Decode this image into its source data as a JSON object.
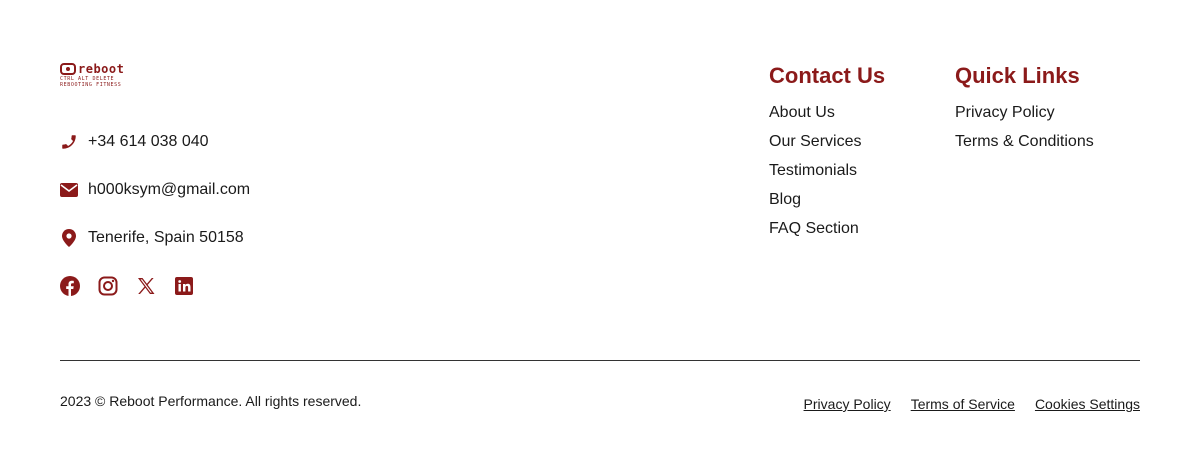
{
  "brand": {
    "logo_word": "reboot",
    "logo_tag_line1": "CTRL ALT DELETE",
    "logo_tag_line2": "REBOOTING FITNESS",
    "accent_color": "#8b1a1a"
  },
  "contact_info": {
    "phone": "+34 614 038 040",
    "email": "h000ksym@gmail.com",
    "location": "Tenerife, Spain 50158"
  },
  "socials": [
    {
      "icon": "facebook-icon"
    },
    {
      "icon": "instagram-icon"
    },
    {
      "icon": "x-icon"
    },
    {
      "icon": "linkedin-icon"
    }
  ],
  "contact_us": {
    "heading": "Contact Us",
    "links": [
      "About Us",
      "Our Services",
      "Testimonials",
      "Blog",
      "FAQ Section"
    ]
  },
  "quick_links": {
    "heading": "Quick Links",
    "links": [
      "Privacy Policy",
      "Terms & Conditions"
    ]
  },
  "footer": {
    "copyright": "2023 © Reboot Performance. All rights reserved.",
    "legal_links": [
      "Privacy Policy",
      "Terms of Service",
      "Cookies Settings"
    ]
  }
}
